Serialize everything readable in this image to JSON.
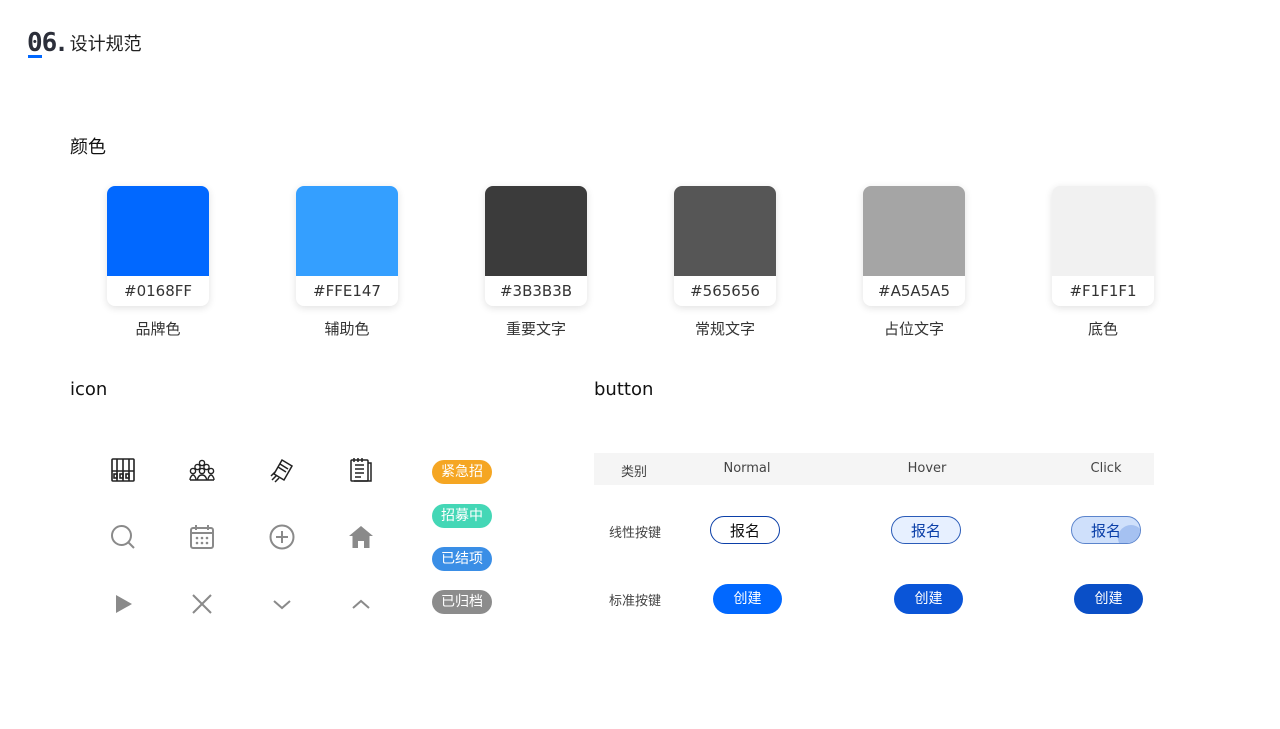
{
  "header": {
    "number": "06",
    "title": "设计规范"
  },
  "colors": {
    "section_title": "颜色",
    "swatches": [
      {
        "hex_label": "#0168FF",
        "fill": "#0168FF",
        "name": "品牌色"
      },
      {
        "hex_label": "#FFE147",
        "fill": "#349FFF",
        "name": "辅助色"
      },
      {
        "hex_label": "#3B3B3B",
        "fill": "#3B3B3B",
        "name": "重要文字"
      },
      {
        "hex_label": "#565656",
        "fill": "#565656",
        "name": "常规文字"
      },
      {
        "hex_label": "#A5A5A5",
        "fill": "#A5A5A5",
        "name": "占位文字"
      },
      {
        "hex_label": "#F1F1F1",
        "fill": "#F1F1F1",
        "name": "底色"
      }
    ]
  },
  "icons": {
    "section_title": "icon",
    "items": [
      "building-icon",
      "crowd-icon",
      "handshake-icon",
      "document-icon",
      "search-icon",
      "calendar-icon",
      "add-circle-icon",
      "home-icon",
      "play-icon",
      "close-icon",
      "chevron-down-icon",
      "chevron-up-icon"
    ],
    "tags": [
      {
        "label": "紧急招",
        "color": "#F5A623"
      },
      {
        "label": "招募中",
        "color": "#44D7B6"
      },
      {
        "label": "已结项",
        "color": "#3A8EE6"
      },
      {
        "label": "已归档",
        "color": "#8C8C8C"
      }
    ]
  },
  "buttons": {
    "section_title": "button",
    "headers": [
      "类别",
      "Normal",
      "Hover",
      "Click"
    ],
    "rows": [
      {
        "label": "线性按键",
        "button_text": "报名"
      },
      {
        "label": "标准按键",
        "button_text": "创建"
      }
    ]
  }
}
